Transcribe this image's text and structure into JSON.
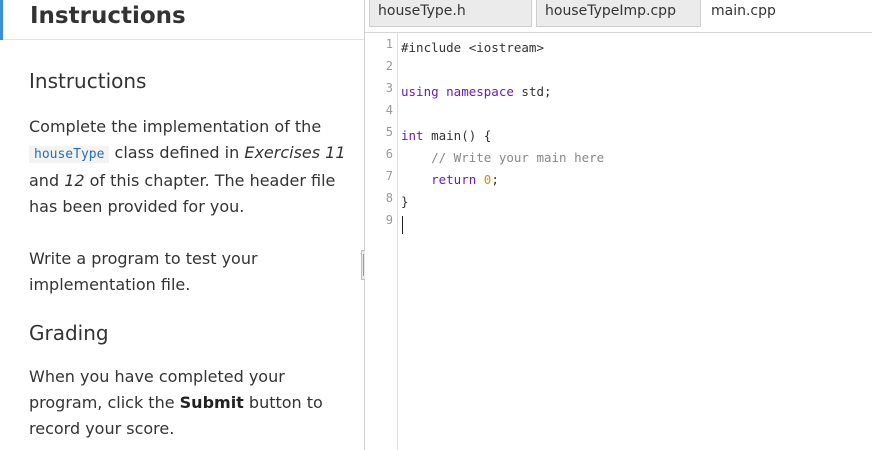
{
  "instructions": {
    "header_title": "Instructions",
    "section_title": "Instructions",
    "p1": {
      "t1": "Complete the implementation of the ",
      "code": "houseType",
      "t2": " class defined in ",
      "em1": "Exercises 11",
      "t3": " and ",
      "em2": "12",
      "t4": " of this chapter. The header file has been provided for you."
    },
    "p2": "Write a program to test your implementation file.",
    "grading_title": "Grading",
    "p3": {
      "t1": "When you have completed your program, click the ",
      "bold": "Submit",
      "t2": " button to record your score."
    }
  },
  "tabs": [
    {
      "label": "houseType.h",
      "active": false
    },
    {
      "label": "houseTypeImp.cpp",
      "active": false
    },
    {
      "label": "main.cpp",
      "active": true
    }
  ],
  "editor": {
    "line_numbers": [
      "1",
      "2",
      "3",
      "4",
      "5",
      "6",
      "7",
      "8",
      "9"
    ],
    "code": {
      "l1": "#include <iostream>",
      "l3_kw": "using namespace",
      "l3_rest": " std;",
      "l5_kw": "int",
      "l5_rest": " main() {",
      "l6_indent": "    ",
      "l6_comment": "// Write your main here",
      "l7_indent": "    ",
      "l7_kw": "return",
      "l7_sp": " ",
      "l7_num": "0",
      "l7_end": ";",
      "l8": "}"
    }
  },
  "colors": {
    "keyword": "#6a1bb5",
    "comment": "#888888",
    "number": "#e08a00",
    "accent": "#3a8fd8",
    "inline_code": "#2a6fb0"
  }
}
